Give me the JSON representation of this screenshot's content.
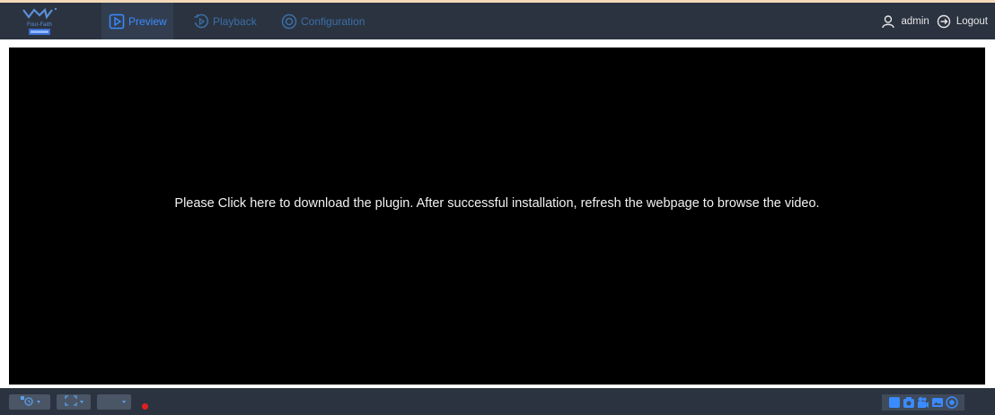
{
  "header": {
    "logo_text": "Four-Faith",
    "nav": [
      {
        "label": "Preview",
        "icon": "play-square-icon",
        "active": true
      },
      {
        "label": "Playback",
        "icon": "playback-icon",
        "active": false
      },
      {
        "label": "Configuration",
        "icon": "settings-circle-icon",
        "active": false
      }
    ],
    "username": "admin",
    "logout_label": "Logout"
  },
  "video": {
    "message": "Please Click here to download the plugin. After successful installation, refresh the webpage to browse the video."
  },
  "toolbar": {
    "left_buttons": [
      "stream-layout-icon",
      "fullscreen-icon",
      "window-select"
    ],
    "right_buttons": [
      "stop-all-icon",
      "snapshot-icon",
      "record-icon",
      "capture-image-icon",
      "start-all-icon"
    ]
  },
  "colors": {
    "header_bg": "#2b3340",
    "accent": "#3a8bff",
    "inactive_nav": "#3b6fa8",
    "record_dot": "#e02020"
  }
}
